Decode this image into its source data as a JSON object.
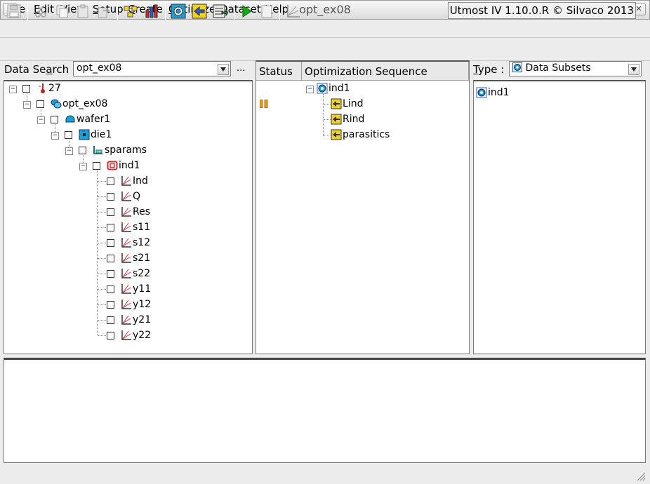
{
  "window": {
    "title": "opt_ex08",
    "btn_min": "▾",
    "btn_max": "▫",
    "btn_close": "✕",
    "btn_menu": "v"
  },
  "menu": [
    {
      "label": "File",
      "accel": "F",
      "rest": "ile"
    },
    {
      "label": "Edit",
      "accel": "E",
      "rest": "dit"
    },
    {
      "label": "View",
      "accel": "V",
      "rest": "iew"
    },
    {
      "label": "Setup",
      "accel": "S",
      "rest": "etup"
    },
    {
      "label": "Create",
      "accel": "C",
      "rest": "reate"
    },
    {
      "label": "Optimize",
      "accel": "O",
      "rest": "ptimize"
    },
    {
      "label": "Dataset",
      "accel": "D",
      "rest": "ataset"
    },
    {
      "label": "Help",
      "accel": "H",
      "rest": "elp"
    }
  ],
  "search": {
    "label_pre": "Data Se",
    "label_accel": "a",
    "label_post": "rch :",
    "value": "opt_ex08",
    "more": "..."
  },
  "tree": {
    "root": "27",
    "project": "opt_ex08",
    "wafer": "wafer1",
    "die": "die1",
    "group": "sparams",
    "device": "ind1",
    "targets": [
      "Ind",
      "Q",
      "Res",
      "s11",
      "s12",
      "s21",
      "s22",
      "y11",
      "y12",
      "y21",
      "y22"
    ]
  },
  "optimization": {
    "col_status": "Status",
    "col_sequence": "Optimization Sequence",
    "root": "ind1",
    "steps": [
      "Lind",
      "Rind",
      "parasitics"
    ]
  },
  "type_panel": {
    "label_accel": "T",
    "label_rest": "ype :",
    "value": "Data Subsets",
    "items": [
      "ind1"
    ]
  },
  "status": {
    "version": "Utmost IV 1.10.0.R © Silvaco 2013"
  },
  "colors": {
    "accent": "#1aa0d8",
    "yellow": "#f2d21a",
    "green": "#18a818",
    "orange": "#e89a1a"
  }
}
